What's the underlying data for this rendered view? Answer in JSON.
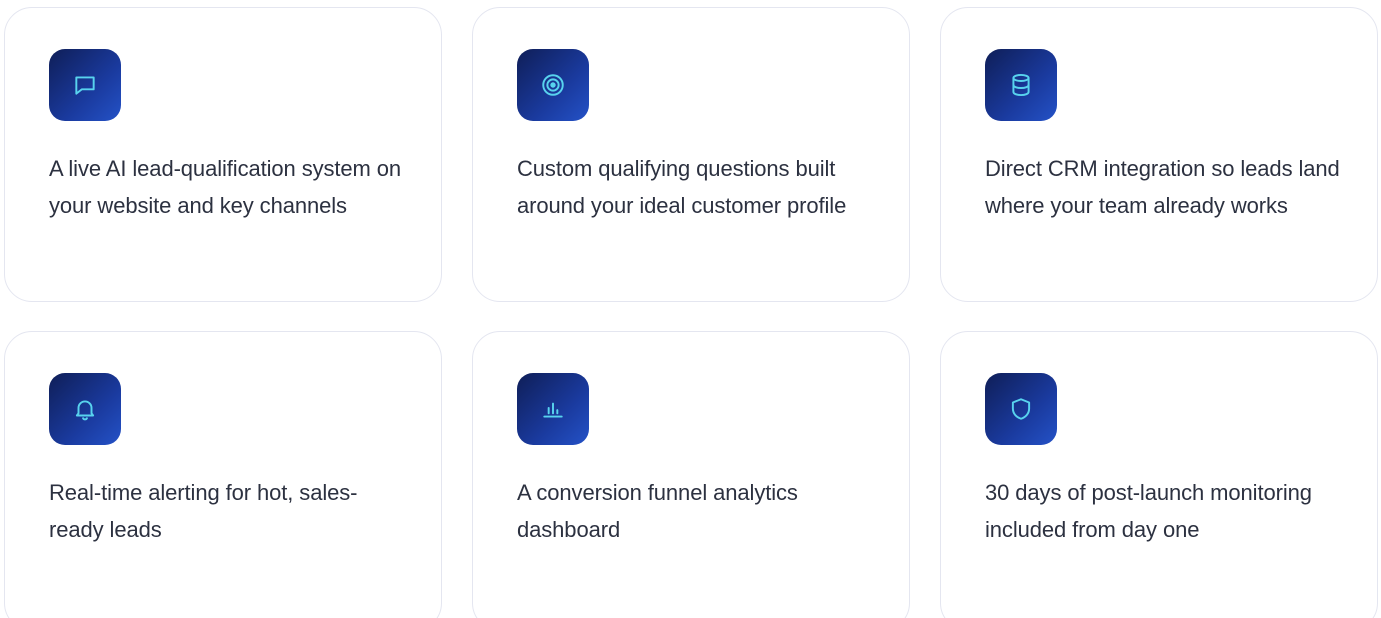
{
  "features": [
    {
      "icon": "chat-bubble-icon",
      "text": "A live AI lead-qualification system on your website and key channels"
    },
    {
      "icon": "target-icon",
      "text": "Custom qualifying questions built around your ideal customer profile"
    },
    {
      "icon": "database-icon",
      "text": "Direct CRM integration so leads land where your team already works"
    },
    {
      "icon": "bell-icon",
      "text": "Real-time alerting for hot, sales-ready leads"
    },
    {
      "icon": "bar-chart-icon",
      "text": "A conversion funnel analytics dashboard"
    },
    {
      "icon": "shield-icon",
      "text": "30 days of post-launch monitoring included from day one"
    }
  ],
  "colors": {
    "icon_stroke": "#58d3ee",
    "tile_dark": "#0f1e57",
    "tile_light": "#2452c7",
    "card_border": "#e4e6f0",
    "text": "#2c3140"
  }
}
